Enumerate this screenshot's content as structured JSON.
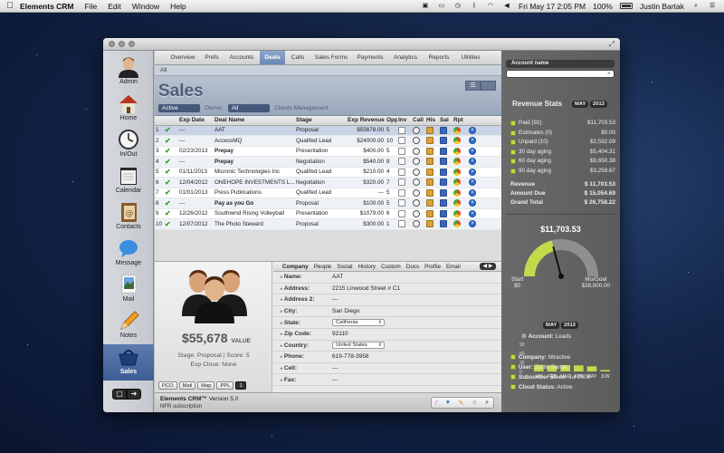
{
  "menubar": {
    "app_name": "Elements CRM",
    "menus": [
      "File",
      "Edit",
      "Window",
      "Help"
    ],
    "clock": "Fri May 17  2:05 PM",
    "battery": "100%",
    "user": "Justin Bartak"
  },
  "sidebar": {
    "items": [
      {
        "label": "Admin",
        "icon": "admin-avatar-icon"
      },
      {
        "label": "Home",
        "icon": "home-icon"
      },
      {
        "label": "In/Out",
        "icon": "clock-icon"
      },
      {
        "label": "Calendar",
        "icon": "calendar-icon"
      },
      {
        "label": "Contacts",
        "icon": "contacts-book-icon"
      },
      {
        "label": "Message",
        "icon": "message-bubble-icon"
      },
      {
        "label": "Mail",
        "icon": "mail-stamp-icon"
      },
      {
        "label": "Notes",
        "icon": "pencil-icon"
      },
      {
        "label": "Sales",
        "icon": "shopping-basket-icon",
        "active": true
      }
    ]
  },
  "tabs": [
    "Overview",
    "Prefs",
    "Accounts",
    "Deals",
    "Calls",
    "Sales Forms",
    "Payments",
    "Analytics",
    "Reports",
    "Utilities"
  ],
  "active_tab": "Deals",
  "subtabs": [
    "All"
  ],
  "header": {
    "title": "Sales",
    "status_filter": "Active",
    "owner_label": "Owner:",
    "owner_value": "All",
    "clients_label": "Clients Management"
  },
  "deals_table": {
    "columns": [
      "",
      "",
      "Exp Date",
      "Deal Name",
      "Stage",
      "Exp Revenue",
      "Opp",
      "Inv",
      "Call",
      "His",
      "Sal",
      "Rpt",
      ""
    ],
    "rows": [
      {
        "num": "1",
        "date": "---",
        "name": "AAT",
        "stage": "Proposal",
        "rev": "$55678.00",
        "opp": "5",
        "bold": false
      },
      {
        "num": "2",
        "date": "---",
        "name": "AccessMQ",
        "stage": "Qualifed Lead",
        "rev": "$24000.00",
        "opp": "10",
        "bold": false
      },
      {
        "num": "3",
        "date": "02/23/2013",
        "name": "Prepay",
        "stage": "Presentation",
        "rev": "$400.00",
        "opp": "5",
        "bold": true
      },
      {
        "num": "4",
        "date": "---",
        "name": "Prepay",
        "stage": "Negotiation",
        "rev": "$540.00",
        "opp": "8",
        "bold": true
      },
      {
        "num": "5",
        "date": "01/11/2013",
        "name": "Micronic Technologies Inc",
        "stage": "Qualifed Lead",
        "rev": "$210.00",
        "opp": "4",
        "bold": false
      },
      {
        "num": "6",
        "date": "12/04/2012",
        "name": "ONEHOPE INVESTMENTS L...",
        "stage": "Negotiation",
        "rev": "$320.00",
        "opp": "7",
        "bold": false
      },
      {
        "num": "7",
        "date": "01/01/2013",
        "name": "Press Publications",
        "stage": "Qualifed Lead",
        "rev": "---",
        "opp": "5",
        "bold": false
      },
      {
        "num": "8",
        "date": "---",
        "name": "Pay as you Go",
        "stage": "Proposal",
        "rev": "$100.00",
        "opp": "5",
        "bold": true
      },
      {
        "num": "9",
        "date": "12/26/2012",
        "name": "Southwind Rising Volleyball",
        "stage": "Presentation",
        "rev": "$1079.00",
        "opp": "6",
        "bold": false
      },
      {
        "num": "10",
        "date": "12/07/2012",
        "name": "The Photo Steward",
        "stage": "Proposal",
        "rev": "$300.00",
        "opp": "1",
        "bold": false
      }
    ]
  },
  "detail": {
    "value": "$55,678",
    "value_unit": "VALUE",
    "stage_line": "Stage: Proposal | Score: 5",
    "close_line": "Exp Close: None",
    "buttons": [
      "PCO",
      "Mail",
      "Map",
      "PPL",
      "1"
    ],
    "info_tabs": [
      "Company",
      "People",
      "Social",
      "History",
      "Custom",
      "Docs",
      "Profile",
      "Email"
    ],
    "fields": [
      {
        "label": "Name:",
        "value": "AAT"
      },
      {
        "label": "Address:",
        "value": "2215 Linwood Street # C1"
      },
      {
        "label": "Address 2:",
        "value": "---"
      },
      {
        "label": "City:",
        "value": "San Diego"
      },
      {
        "label": "State:",
        "value": "California",
        "select": true
      },
      {
        "label": "Zip Code:",
        "value": "92110"
      },
      {
        "label": "Country:",
        "value": "United States",
        "select": true
      },
      {
        "label": "Phone:",
        "value": "619-778-3958"
      },
      {
        "label": "Cell:",
        "value": "---"
      },
      {
        "label": "Fax:",
        "value": "---"
      }
    ]
  },
  "footer": {
    "app": "Elements CRM™",
    "version": "Version 5.0",
    "subscription": "NFR subscription"
  },
  "right": {
    "account_label": "Account name",
    "stats_title": "Revenue Stats",
    "month": "MAY",
    "year": "2013",
    "stats": [
      {
        "label": "Paid (92)",
        "value": "$11,703.53"
      },
      {
        "label": "Estimates (0)",
        "value": "$0.00"
      },
      {
        "label": "Unpaid (10)",
        "value": "$2,592.09"
      },
      {
        "label": "30 day aging",
        "value": "$5,404.31"
      },
      {
        "label": "60 day aging",
        "value": "$9,650.38"
      },
      {
        "label": "90 day aging",
        "value": "$3,259.67"
      }
    ],
    "totals": [
      {
        "label": "Revenue",
        "value": "$ 11,703.53"
      },
      {
        "label": "Amount Due",
        "value": "$ 15,054.69"
      },
      {
        "label": "Grand Total",
        "value": "$ 26,758.22"
      }
    ],
    "gauge": {
      "amount": "$11,703.53",
      "start_label": "Start",
      "start_value": "$0",
      "goal_label": "Mo/Goal",
      "goal_value": "$28,000.00",
      "fraction": 0.418
    },
    "leads_label": "Account:",
    "leads_value": "Leads",
    "leads_chart": {
      "type": "bar",
      "categories": [
        "JAN",
        "FEB",
        "MAR",
        "APR",
        "MAY",
        "JUN"
      ],
      "values": [
        22,
        20,
        21,
        20,
        17,
        5
      ],
      "yticks": [
        "90",
        "60",
        "30",
        "0"
      ],
      "ylim": [
        0,
        90
      ]
    },
    "footer_rows": [
      {
        "label": "Company:",
        "value": "Ntractive"
      },
      {
        "label": "User:",
        "value": "Justin Bartak"
      },
      {
        "label": "Subscriber Since:",
        "value": "Jul 2006"
      },
      {
        "label": "Cloud Status:",
        "value": "Active"
      }
    ],
    "accent_color": "#c4d94a"
  }
}
